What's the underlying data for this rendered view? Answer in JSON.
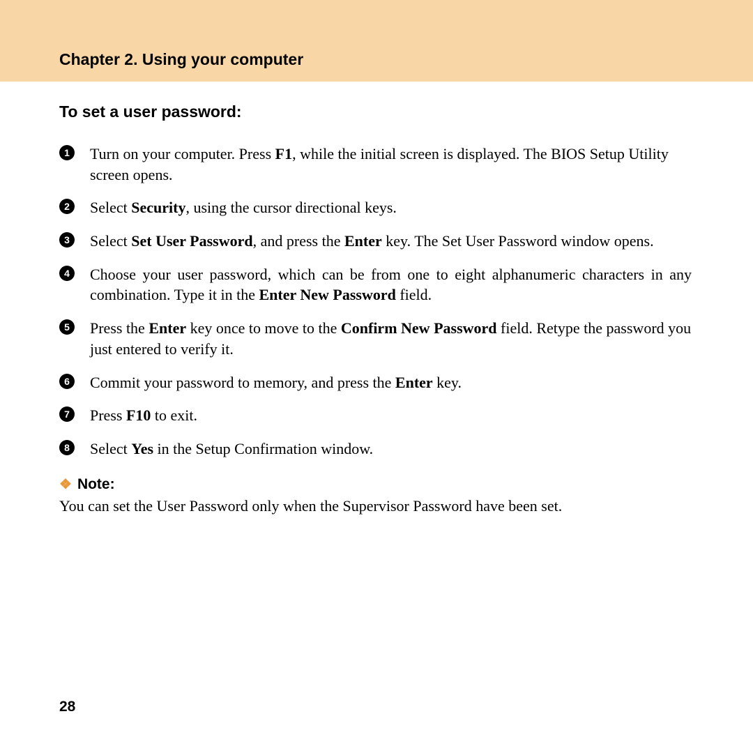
{
  "header": {
    "chapter_title": "Chapter 2. Using your computer"
  },
  "section": {
    "heading": "To set a user password:"
  },
  "steps": [
    {
      "n": "1",
      "html": "Turn on your computer. Press <b>F1</b>, while the initial screen is displayed. The BIOS Setup Utility screen opens.",
      "justify": false
    },
    {
      "n": "2",
      "html": "Select <b>Security</b>, using the cursor directional keys.",
      "justify": false
    },
    {
      "n": "3",
      "html": "Select <b>Set User Password</b>, and press the <b>Enter</b> key. The Set User Password window opens.",
      "justify": true
    },
    {
      "n": "4",
      "html": "Choose your user password, which can be from one to eight alphanumeric characters in any combination. Type it in the <b>Enter New Password</b> field.",
      "justify": true
    },
    {
      "n": "5",
      "html": "Press the <b>Enter</b> key once to move to the <b>Confirm New Password</b> field. Retype the password you just entered to verify it.",
      "justify": false
    },
    {
      "n": "6",
      "html": "Commit your password to memory, and press the <b>Enter</b> key.",
      "justify": false
    },
    {
      "n": "7",
      "html": "Press <b>F10</b> to exit.",
      "justify": false
    },
    {
      "n": "8",
      "html": "Select <b>Yes</b> in the Setup Confirmation window.",
      "justify": false
    }
  ],
  "note": {
    "label": "Note:",
    "text": "You can set the User Password only when the Supervisor Password have been set."
  },
  "page_number": "28"
}
